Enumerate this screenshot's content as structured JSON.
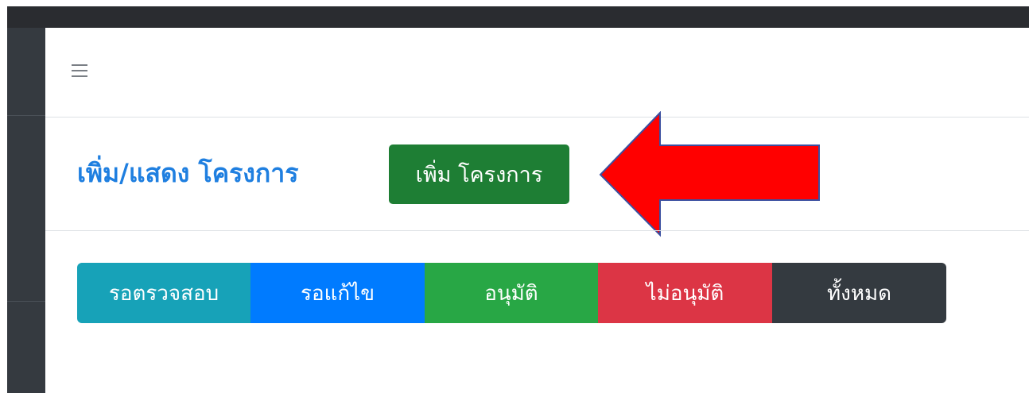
{
  "header": {
    "menu_icon": "hamburger-menu-icon"
  },
  "page": {
    "title": "เพิ่ม/แสดง โครงการ",
    "add_button_label": "เพิ่ม โครงการ"
  },
  "annotation": {
    "arrow_icon": "red-arrow-left-icon",
    "arrow_color": "#ff0000",
    "arrow_outline": "#3a4fa0"
  },
  "filters": {
    "pending_review": "รอตรวจสอบ",
    "pending_edit": "รอแก้ไข",
    "approved": "อนุมัติ",
    "not_approved": "ไม่อนุมัติ",
    "all": "ทั้งหมด"
  },
  "colors": {
    "title": "#1f7fe0",
    "add_button": "#1e7e34",
    "pending_review": "#17a2b8",
    "pending_edit": "#007bff",
    "approved": "#28a745",
    "not_approved": "#dc3545",
    "all": "#343a40"
  }
}
